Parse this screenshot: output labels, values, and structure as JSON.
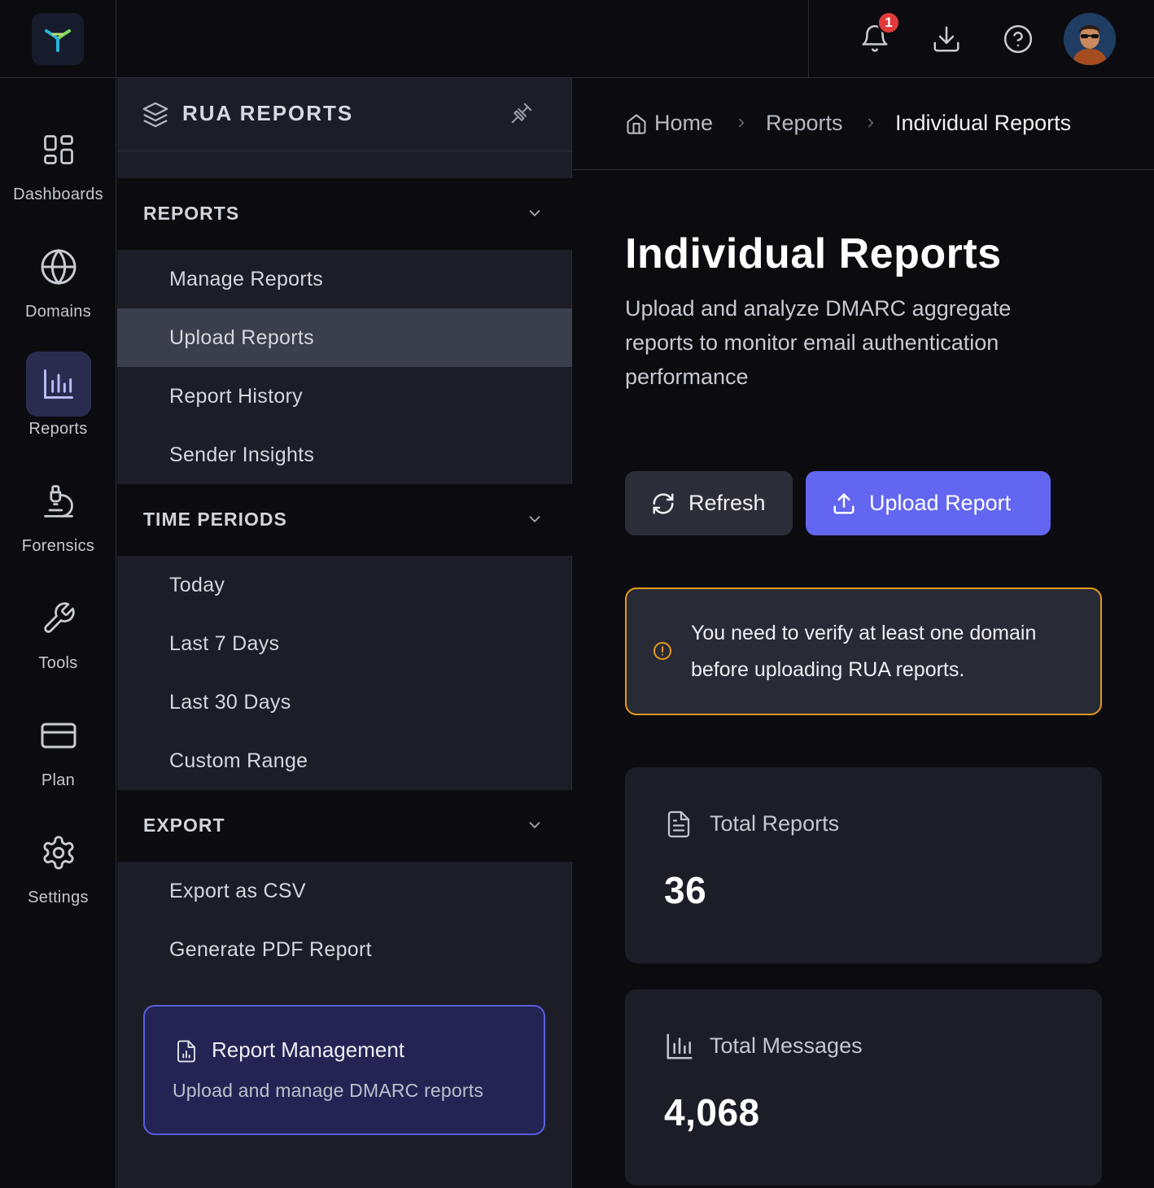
{
  "topbar": {
    "notifications_count": "1",
    "notifications_icon": "bell-icon",
    "download_icon": "download-icon",
    "help_icon": "help-circle-icon",
    "avatar_icon": "user-avatar"
  },
  "rail": {
    "items": [
      {
        "label": "Dashboards",
        "icon": "dashboard-grid-icon"
      },
      {
        "label": "Domains",
        "icon": "globe-icon"
      },
      {
        "label": "Reports",
        "icon": "bar-chart-icon",
        "active": true
      },
      {
        "label": "Forensics",
        "icon": "microscope-icon"
      },
      {
        "label": "Tools",
        "icon": "wrench-icon"
      },
      {
        "label": "Plan",
        "icon": "credit-card-icon"
      },
      {
        "label": "Settings",
        "icon": "gear-icon"
      }
    ]
  },
  "sidebar": {
    "title": "RUA REPORTS",
    "sections": [
      {
        "label": "REPORTS",
        "items": [
          "Manage Reports",
          "Upload Reports",
          "Report History",
          "Sender Insights"
        ],
        "active_item": "Upload Reports"
      },
      {
        "label": "TIME PERIODS",
        "items": [
          "Today",
          "Last 7 Days",
          "Last 30 Days",
          "Custom Range"
        ]
      },
      {
        "label": "EXPORT",
        "items": [
          "Export as CSV",
          "Generate PDF Report"
        ]
      }
    ],
    "card": {
      "title": "Report Management",
      "subtitle": "Upload and manage DMARC reports"
    }
  },
  "breadcrumb": [
    "Home",
    "Reports",
    "Individual Reports"
  ],
  "main": {
    "title": "Individual Reports",
    "description": "Upload and analyze DMARC aggregate reports to monitor email authentication performance",
    "refresh_label": "Refresh",
    "upload_label": "Upload Report",
    "alert": "You need to verify at least one domain before uploading RUA reports.",
    "stats": [
      {
        "label": "Total Reports",
        "value": "36",
        "icon": "document-icon"
      },
      {
        "label": "Total Messages",
        "value": "4,068",
        "icon": "bar-chart-icon"
      }
    ]
  },
  "colors": {
    "accent": "#6266f0",
    "warning": "#e59a1a",
    "badge": "#e23a3a"
  }
}
